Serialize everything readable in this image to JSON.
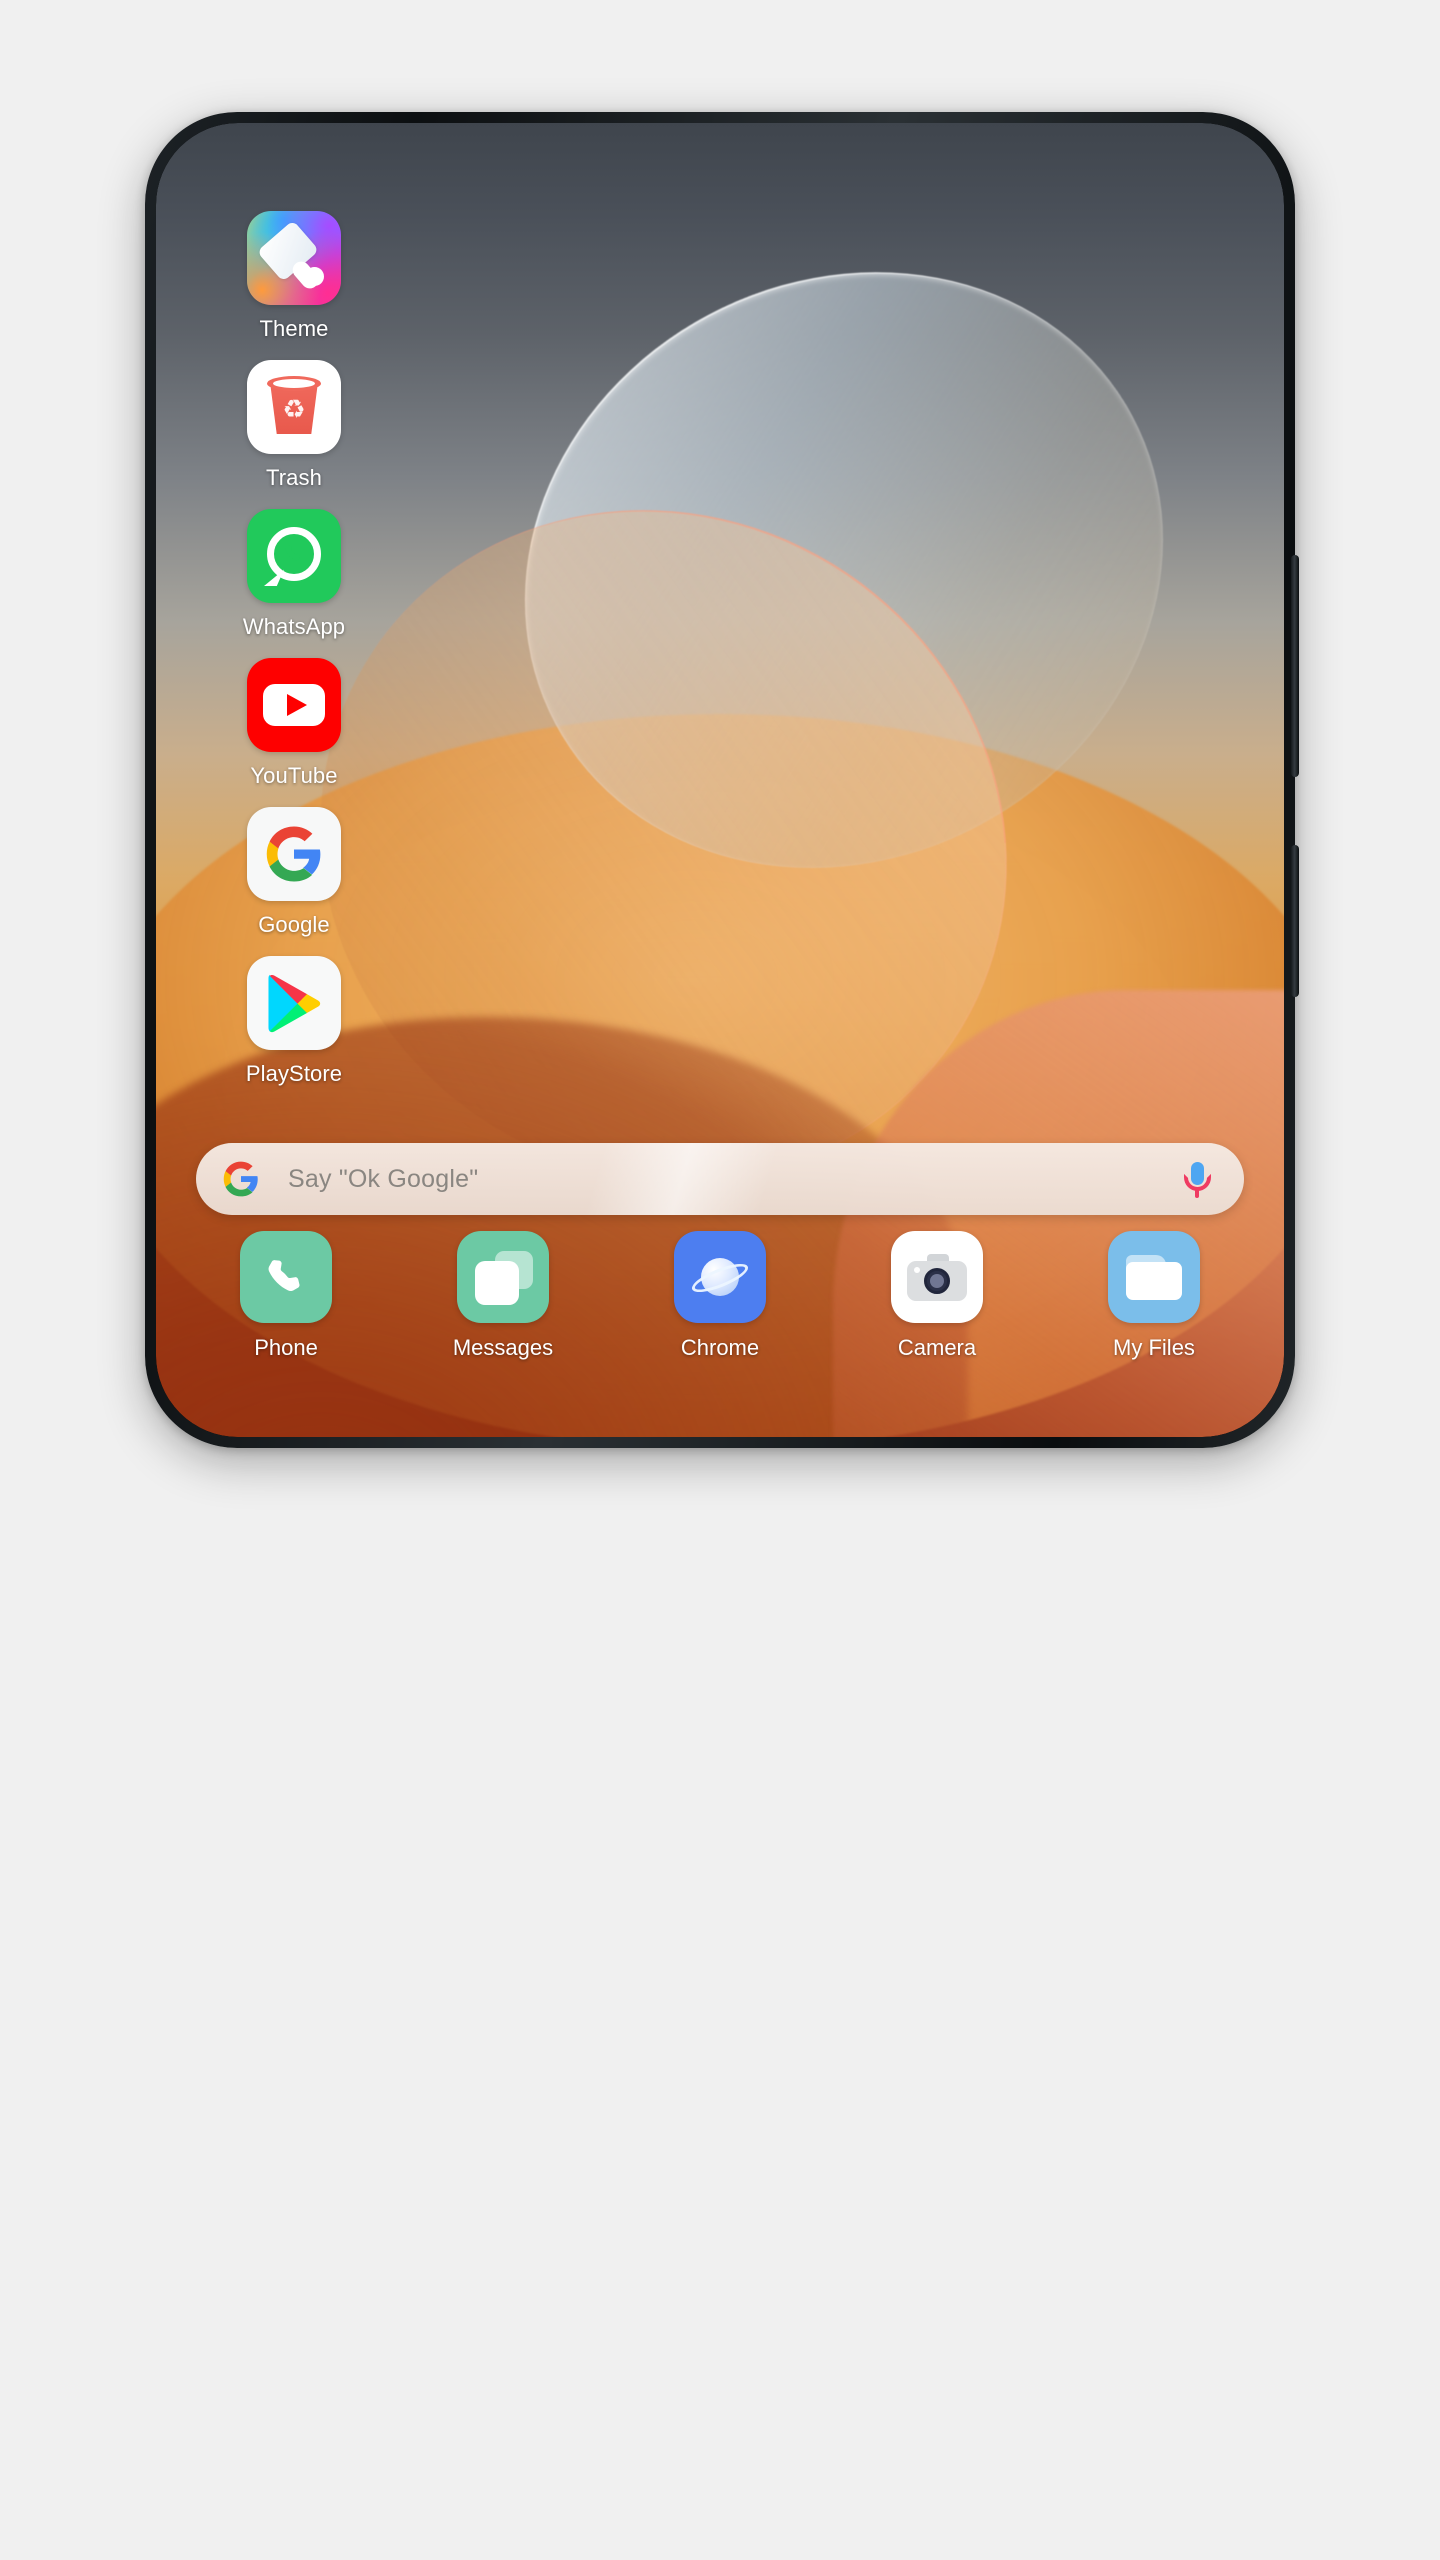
{
  "device": {
    "type": "smartphone",
    "hardware_buttons": [
      {
        "name": "volume-rocker"
      },
      {
        "name": "power-button"
      }
    ]
  },
  "wallpaper": {
    "description": "abstract overlapping translucent petals over grey-to-orange gradient",
    "colors": {
      "top": "#3f454d",
      "mid": "#dca963",
      "bottom": "#93300f",
      "petal_cool": "#e8f0f6",
      "petal_warm": "#fad4b0",
      "disc": "#f4b96c"
    }
  },
  "home": {
    "apps": [
      {
        "label": "Theme",
        "icon": "theme-paintbrush-icon"
      },
      {
        "label": "Trash",
        "icon": "trash-bin-icon"
      },
      {
        "label": "WhatsApp",
        "icon": "whatsapp-icon"
      },
      {
        "label": "YouTube",
        "icon": "youtube-icon"
      },
      {
        "label": "Google",
        "icon": "google-g-icon"
      },
      {
        "label": "PlayStore",
        "icon": "play-store-icon"
      }
    ]
  },
  "search": {
    "placeholder": "Say \"Ok Google\"",
    "left_icon": "google-g-icon",
    "right_icon": "microphone-icon",
    "accent_mic_cap": "#4ea6f2",
    "accent_mic_arc": "#ef3b62",
    "background": "#f0e5dd"
  },
  "dock": {
    "apps": [
      {
        "label": "Phone",
        "icon": "phone-handset-icon",
        "color": "#6cc9a4"
      },
      {
        "label": "Messages",
        "icon": "messages-chat-icon",
        "color": "#6cc9a4"
      },
      {
        "label": "Chrome",
        "icon": "browser-planet-icon",
        "color": "#4d7ef0"
      },
      {
        "label": "Camera",
        "icon": "camera-icon",
        "color": "#ffffff"
      },
      {
        "label": "My Files",
        "icon": "folder-icon",
        "color": "#7bbeea"
      }
    ]
  }
}
